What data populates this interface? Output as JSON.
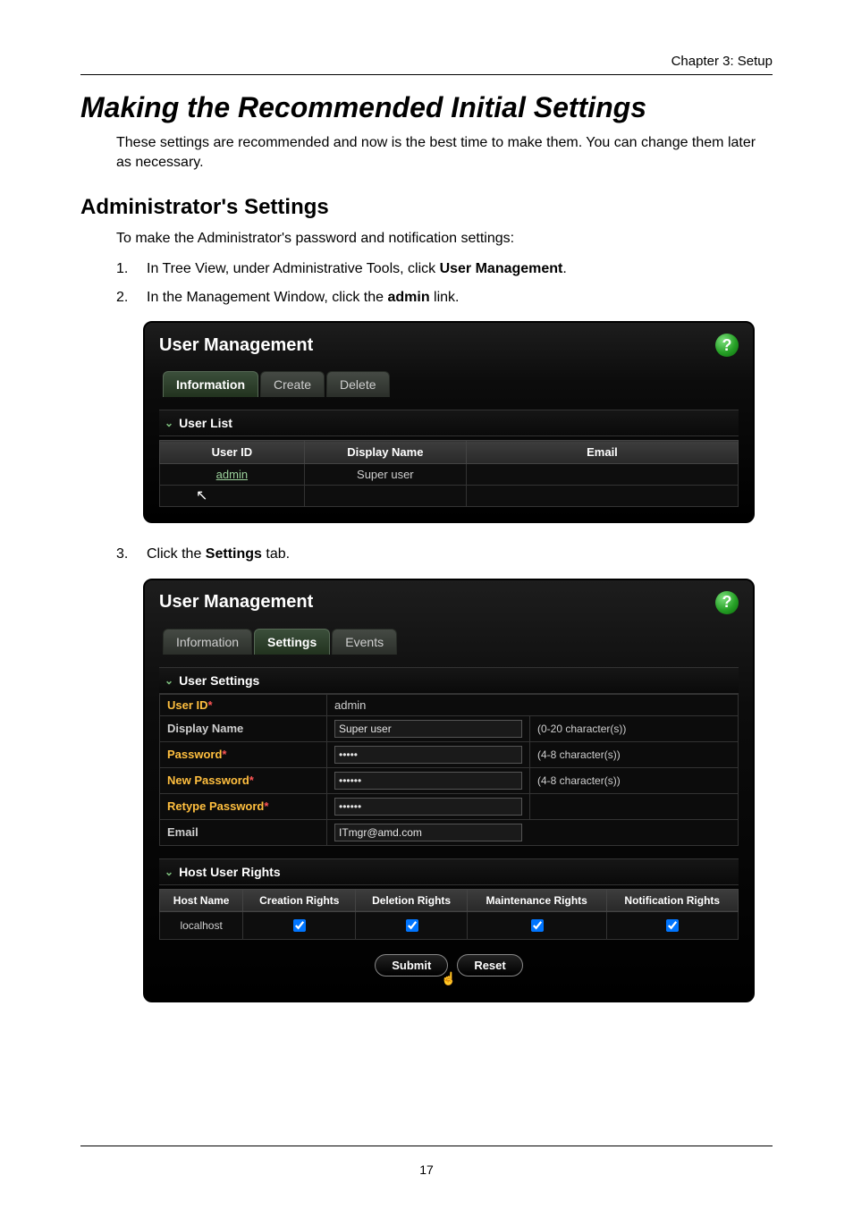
{
  "chapter": "Chapter 3: Setup",
  "title": "Making the Recommended Initial Settings",
  "intro": "These settings are recommended and now is the best time to make them. You can change them later as necessary.",
  "section_admin": "Administrator's Settings",
  "admin_intro": "To make the Administrator's password and notification settings:",
  "steps": [
    {
      "n": "1.",
      "pre": "In Tree View, under Administrative Tools, click ",
      "bold": "User Management",
      "post": "."
    },
    {
      "n": "2.",
      "pre": "In the Management Window, click the ",
      "bold": "admin",
      "post": " link."
    }
  ],
  "step3": {
    "n": "3.",
    "pre": "Click the ",
    "bold": "Settings",
    "post": " tab."
  },
  "panel1": {
    "title": "User Management",
    "help": "?",
    "tabs": {
      "information": "Information",
      "create": "Create",
      "delete": "Delete"
    },
    "list_header": "User List",
    "cols": {
      "id": "User ID",
      "name": "Display Name",
      "email": "Email"
    },
    "row": {
      "id": "admin",
      "name": "Super user",
      "email": ""
    }
  },
  "panel2": {
    "title": "User Management",
    "help": "?",
    "tabs": {
      "information": "Information",
      "settings": "Settings",
      "events": "Events"
    },
    "settings_header": "User Settings",
    "labels": {
      "user_id": "User ID",
      "display_name": "Display Name",
      "password": "Password",
      "new_password": "New Password",
      "retype_password": "Retype Password",
      "email": "Email"
    },
    "values": {
      "user_id": "admin",
      "display_name": "Super user",
      "password": "•••••",
      "new_password": "••••••",
      "retype_password": "••••••",
      "email": "ITmgr@amd.com"
    },
    "hints": {
      "display_name": "(0-20 character(s))",
      "password": "(4-8 character(s))",
      "new_password": "(4-8 character(s))"
    },
    "rights_header": "Host User Rights",
    "rights_cols": {
      "host": "Host Name",
      "creation": "Creation Rights",
      "deletion": "Deletion Rights",
      "maintenance": "Maintenance Rights",
      "notification": "Notification Rights"
    },
    "rights_row": {
      "host": "localhost",
      "creation": true,
      "deletion": true,
      "maintenance": true,
      "notification": true
    },
    "buttons": {
      "submit": "Submit",
      "reset": "Reset"
    }
  },
  "page_number": "17"
}
